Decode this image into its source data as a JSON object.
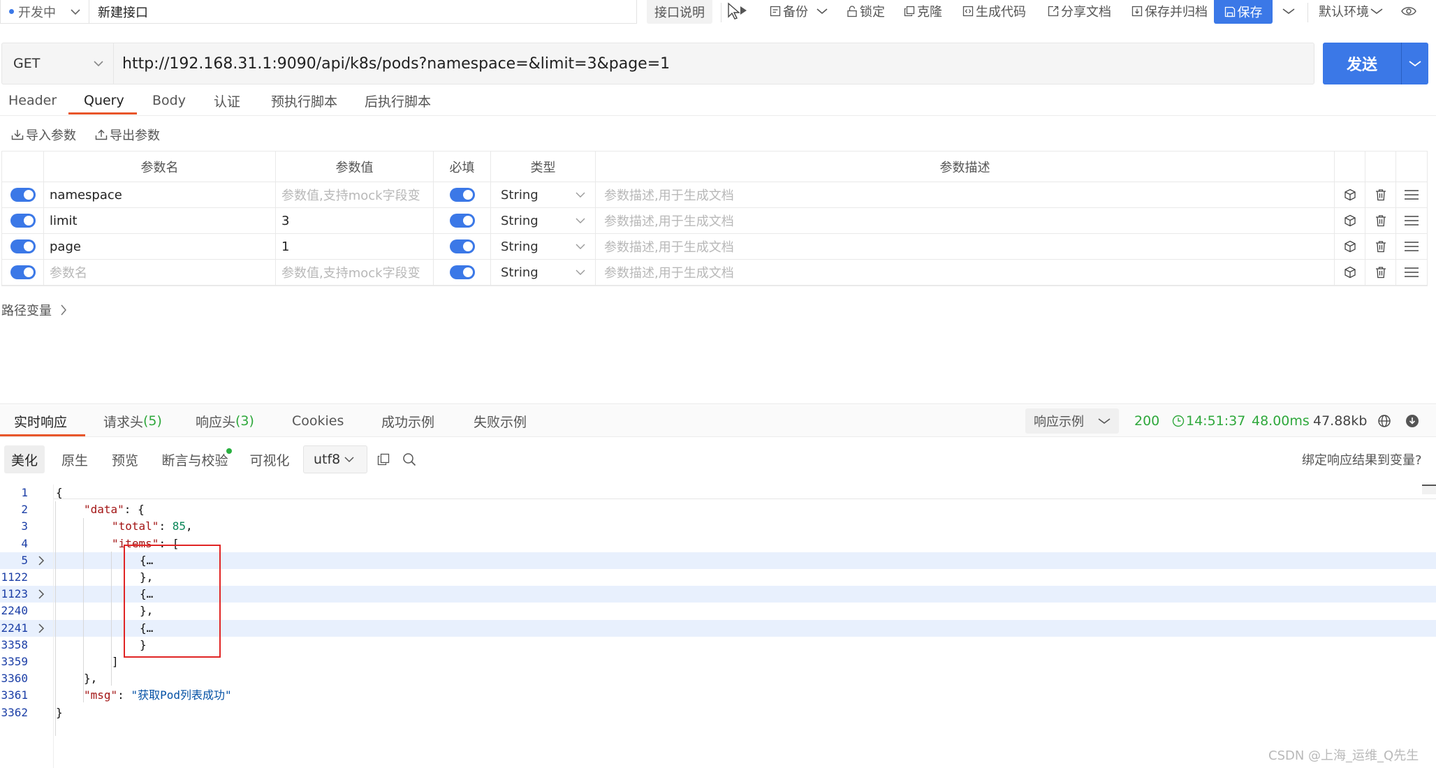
{
  "toolbar": {
    "status": "开发中",
    "api_name": "新建接口",
    "doc_button": "接口说明",
    "backup": "备份",
    "lock": "锁定",
    "clone": "克隆",
    "gen_code": "生成代码",
    "share_doc": "分享文档",
    "save_archive": "保存并归档",
    "save": "保存",
    "environment": "默认环境"
  },
  "request": {
    "method": "GET",
    "url": "http://192.168.31.1:9090/api/k8s/pods?namespace=&limit=3&page=1",
    "send": "发送"
  },
  "request_tabs": [
    "Header",
    "Query",
    "Body",
    "认证",
    "预执行脚本",
    "后执行脚本"
  ],
  "request_tab_active": "Query",
  "params_actions": {
    "import": "导入参数",
    "export": "导出参数"
  },
  "params_table": {
    "headers": [
      "参数名",
      "参数值",
      "必填",
      "类型",
      "参数描述"
    ],
    "rows": [
      {
        "name": "namespace",
        "value": "",
        "value_placeholder": "参数值,支持mock字段变",
        "required": true,
        "type": "String",
        "desc_placeholder": "参数描述,用于生成文档"
      },
      {
        "name": "limit",
        "value": "3",
        "value_placeholder": "",
        "required": true,
        "type": "String",
        "desc_placeholder": "参数描述,用于生成文档"
      },
      {
        "name": "page",
        "value": "1",
        "value_placeholder": "",
        "required": true,
        "type": "String",
        "desc_placeholder": "参数描述,用于生成文档"
      },
      {
        "name": "",
        "name_placeholder": "参数名",
        "value": "",
        "value_placeholder": "参数值,支持mock字段变",
        "required": true,
        "type": "String",
        "desc_placeholder": "参数描述,用于生成文档"
      }
    ]
  },
  "path_vars_label": "路径变量",
  "response_tabs": [
    {
      "label": "实时响应"
    },
    {
      "label": "请求头",
      "count": "(5)"
    },
    {
      "label": "响应头",
      "count": "(3)"
    },
    {
      "label": "Cookies"
    },
    {
      "label": "成功示例"
    },
    {
      "label": "失败示例"
    }
  ],
  "response_example_select": "响应示例",
  "response_stats": {
    "status": "200",
    "time": "14:51:37",
    "duration": "48.00ms",
    "size": "47.88kb"
  },
  "view_modes": [
    "美化",
    "原生",
    "预览",
    "断言与校验",
    "可视化"
  ],
  "encoding": "utf8",
  "bind_link": "绑定响应结果到变量?",
  "code_lines": [
    {
      "ln": "1",
      "text": "{"
    },
    {
      "ln": "2",
      "key": "\"data\"",
      "rest": ": {"
    },
    {
      "ln": "3",
      "key": "\"total\"",
      "rest": ": ",
      "num": "85",
      "tail": ","
    },
    {
      "ln": "4",
      "key": "\"items\"",
      "rest": ": ["
    },
    {
      "ln": "5",
      "text": "{…"
    },
    {
      "ln": "1122",
      "text": "},"
    },
    {
      "ln": "1123",
      "text": "{…"
    },
    {
      "ln": "2240",
      "text": "},"
    },
    {
      "ln": "2241",
      "text": "{…"
    },
    {
      "ln": "3358",
      "text": "}"
    },
    {
      "ln": "3359",
      "text": "]"
    },
    {
      "ln": "3360",
      "text": "},"
    },
    {
      "ln": "3361",
      "key": "\"msg\"",
      "rest": ": ",
      "str": "\"获取Pod列表成功\""
    },
    {
      "ln": "3362",
      "text": "}"
    }
  ],
  "watermark": "CSDN @上海_运维_Q先生",
  "colors": {
    "accent": "#3b78e7",
    "tab_underline": "#e8562a",
    "success": "#2fa83c",
    "highlight_box": "#e02525"
  }
}
